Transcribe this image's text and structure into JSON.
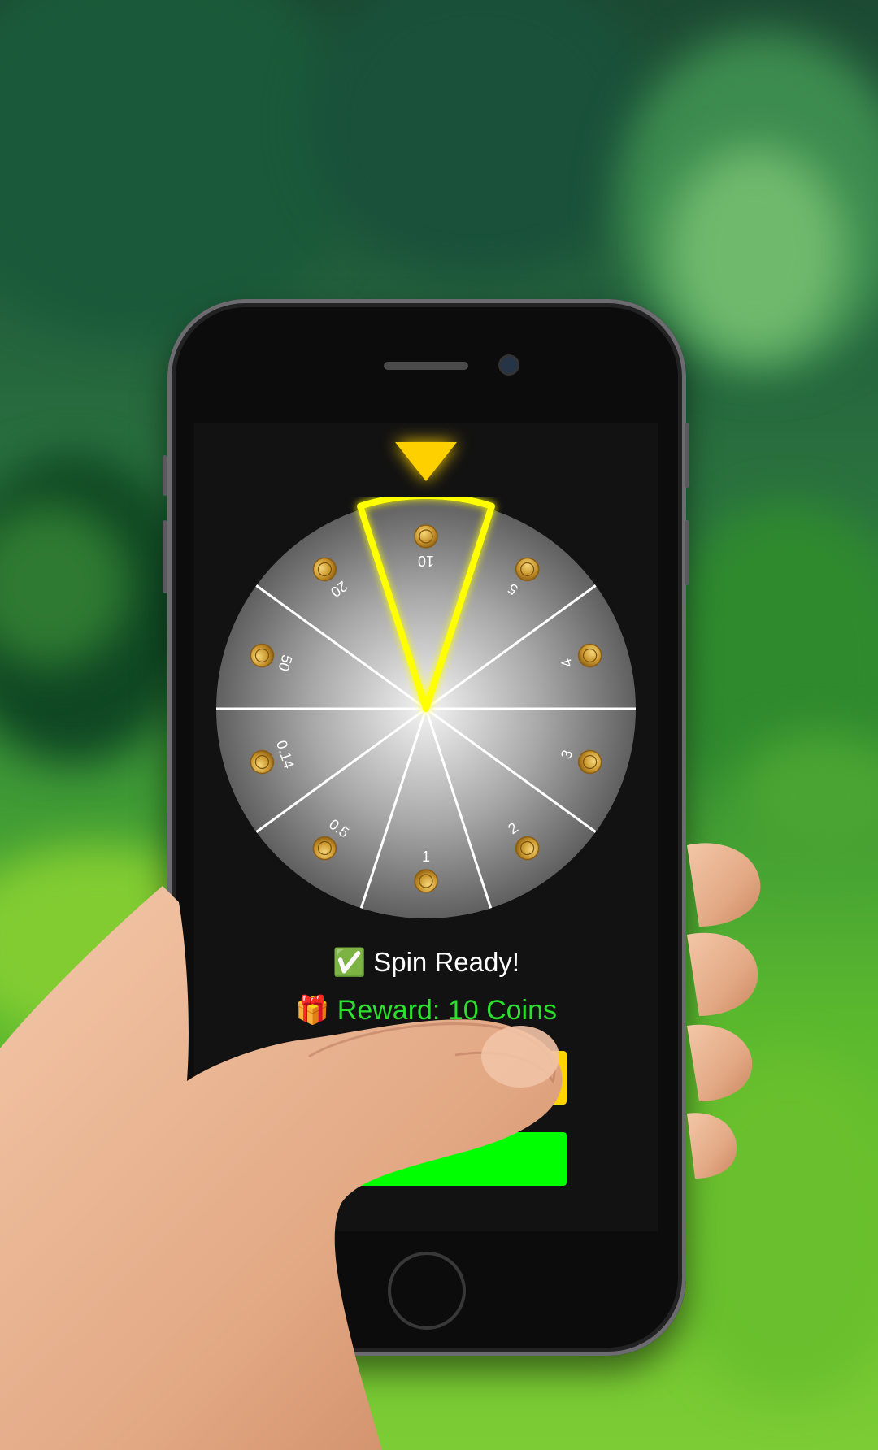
{
  "screen": {
    "status_icon": "✅",
    "status_text": "Spin Ready!",
    "reward_icon": "🎁",
    "reward_text": "Reward: 10 Coins",
    "spin_button_label": "",
    "claim_button_label": ""
  },
  "wheel": {
    "segments": [
      "10",
      "5",
      "4",
      "3",
      "2",
      "1",
      "0.5",
      "0.14",
      "50",
      "20"
    ],
    "selected": "10"
  },
  "colors": {
    "highlight": "#ffff00",
    "pointer": "#ffd000",
    "spin_button": "#ffd400",
    "claim_button": "#00ff00",
    "reward_text": "#2ddf2d"
  },
  "icons": [
    "coin-icon",
    "pointer-icon",
    "checkmark-icon",
    "gift-icon"
  ]
}
